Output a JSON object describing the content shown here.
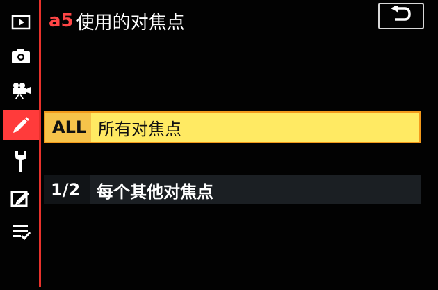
{
  "header": {
    "code": "a5",
    "title": "使用的对焦点"
  },
  "back_button": {
    "icon": "return-arrow-icon"
  },
  "sidebar": {
    "items": [
      {
        "icon": "playback-icon"
      },
      {
        "icon": "camera-icon"
      },
      {
        "icon": "movie-camera-icon"
      },
      {
        "icon": "pencil-icon",
        "active": true
      },
      {
        "icon": "wrench-icon"
      },
      {
        "icon": "retouch-icon"
      },
      {
        "icon": "my-menu-icon"
      }
    ]
  },
  "options": [
    {
      "key": "ALL",
      "label": "所有对焦点",
      "selected": true
    },
    {
      "key": "1/2",
      "label": "每个其他对焦点",
      "selected": false
    }
  ],
  "colors": {
    "accent_red": "#ff3b3b",
    "selected_bg": "#ffea63",
    "selected_key_bg": "#f6c34a",
    "selected_border": "#f39a1c"
  }
}
